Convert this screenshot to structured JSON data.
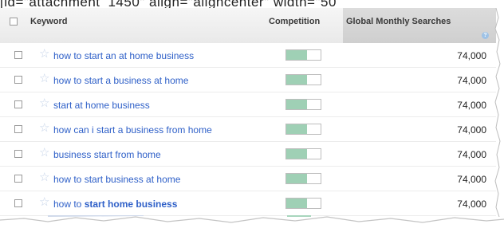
{
  "caption": "[id=\"attachment_1450\" align=\"aligncenter\" width=\"50",
  "table": {
    "headers": {
      "keyword": "Keyword",
      "competition": "Competition",
      "searches": "Global Monthly Searches"
    },
    "help_icon": "?",
    "rows": [
      {
        "keyword": "how to start an at home business",
        "competition": 0.6,
        "searches": "74,000"
      },
      {
        "keyword": "how to start a business at home",
        "competition": 0.6,
        "searches": "74,000"
      },
      {
        "keyword": "start at home business",
        "competition": 0.6,
        "searches": "74,000"
      },
      {
        "keyword": "how can i start a business from home",
        "competition": 0.6,
        "searches": "74,000"
      },
      {
        "keyword": "business start from home",
        "competition": 0.6,
        "searches": "74,000"
      },
      {
        "keyword": "how to start business at home",
        "competition": 0.6,
        "searches": "74,000"
      },
      {
        "keyword_plain": "how to ",
        "keyword_bold": "start home business",
        "competition": 0.6,
        "searches": "74,000"
      }
    ]
  },
  "colors": {
    "link": "#2f60c8",
    "competition_fill": "#9fd0b5",
    "star": "#c5d3e8",
    "sorted_column_bg": "#d4d4d4"
  },
  "icons": {
    "star": "star-icon",
    "help": "help-icon",
    "checkbox": "checkbox"
  }
}
